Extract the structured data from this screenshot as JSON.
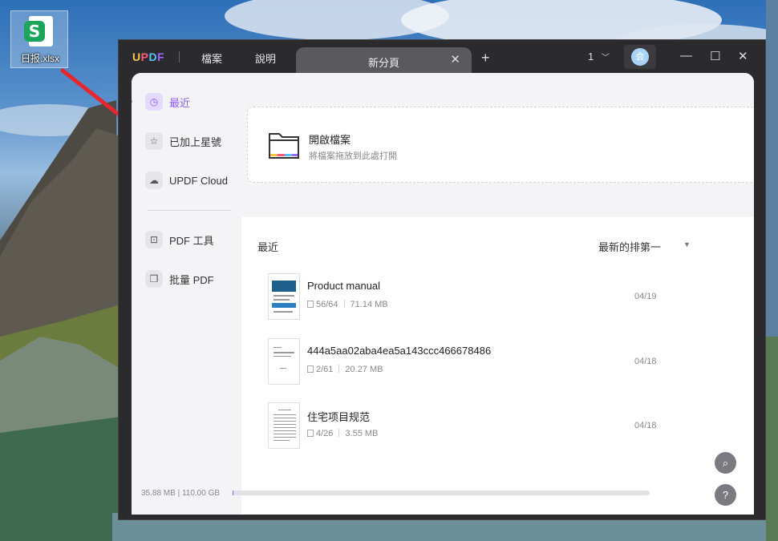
{
  "desktop": {
    "icon_label": "日报.xlsx",
    "icon_glyph": "S"
  },
  "window": {
    "logo": {
      "u": "U",
      "p": "P",
      "d": "D",
      "f": "F"
    },
    "menu": [
      "檔案",
      "說明"
    ],
    "tab_label": "新分頁",
    "tab_close": "✕",
    "new_tab": "+",
    "page_count": "1",
    "avatar_initial": "会",
    "controls": {
      "minimize": "—",
      "maximize": "☐",
      "close": "✕"
    }
  },
  "sidebar": {
    "items": [
      {
        "label": "最近",
        "icon": "clock-icon",
        "glyph": "◷"
      },
      {
        "label": "已加上星號",
        "icon": "star-icon",
        "glyph": "☆"
      },
      {
        "label": "UPDF Cloud",
        "icon": "cloud-icon",
        "glyph": "☁"
      },
      {
        "label": "PDF 工具",
        "icon": "toolbox-icon",
        "glyph": "⊡"
      },
      {
        "label": "批量 PDF",
        "icon": "batch-icon",
        "glyph": "❐"
      }
    ]
  },
  "open_file": {
    "title": "開啟檔案",
    "subtitle": "將檔案拖放到此處打開"
  },
  "recent": {
    "heading": "最近",
    "sort_label": "最新的排第一",
    "sort_caret": "▼",
    "files": [
      {
        "name": "Product manual",
        "pages": "56/64",
        "size": "71.14 MB",
        "date": "04/19"
      },
      {
        "name": "444a5aa02aba4ea5a143ccc466678486",
        "pages": "2/61",
        "size": "20.27 MB",
        "date": "04/18"
      },
      {
        "name": "住宅项目规范",
        "pages": "4/26",
        "size": "3.55 MB",
        "date": "04/18"
      }
    ]
  },
  "storage": {
    "text": "35.88 MB | 110.00 GB",
    "used_fraction": 0.0003
  },
  "fabs": {
    "search": "⌕",
    "help": "?"
  },
  "colors": {
    "accent": "#8b5cf6",
    "arrow": "#e8262e"
  }
}
